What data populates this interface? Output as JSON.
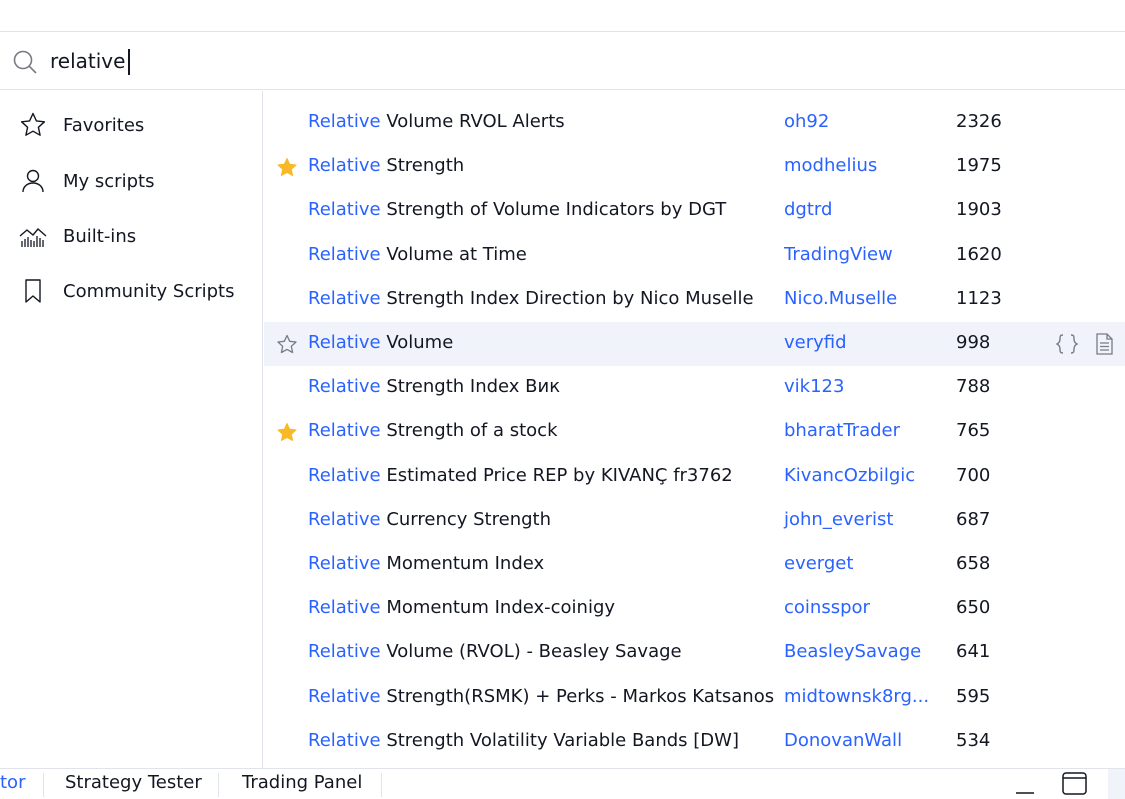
{
  "search": {
    "value": "relative"
  },
  "sidebar": {
    "items": [
      {
        "label": "Favorites",
        "icon": "star-outline-icon"
      },
      {
        "label": "My scripts",
        "icon": "user-icon"
      },
      {
        "label": "Built-ins",
        "icon": "chart-icon"
      },
      {
        "label": "Community Scripts",
        "icon": "bookmark-icon"
      }
    ]
  },
  "results": [
    {
      "hit": "Relative",
      "rest": " Volume RVOL Alerts",
      "author": "oh92",
      "count": "2326",
      "favorite": "none"
    },
    {
      "hit": "Relative",
      "rest": " Strength",
      "author": "modhelius",
      "count": "1975",
      "favorite": "filled"
    },
    {
      "hit": "Relative",
      "rest": " Strength of Volume Indicators by DGT",
      "author": "dgtrd",
      "count": "1903",
      "favorite": "none"
    },
    {
      "hit": "Relative",
      "rest": " Volume at Time",
      "author": "TradingView",
      "count": "1620",
      "favorite": "none"
    },
    {
      "hit": "Relative",
      "rest": " Strength Index Direction by Nico Muselle",
      "author": "Nico.Muselle",
      "count": "1123",
      "favorite": "none"
    },
    {
      "hit": "Relative",
      "rest": " Volume",
      "author": "veryfid",
      "count": "998",
      "favorite": "outline"
    },
    {
      "hit": "Relative",
      "rest": " Strength Index Вик",
      "author": "vik123",
      "count": "788",
      "favorite": "none"
    },
    {
      "hit": "Relative",
      "rest": " Strength of a stock",
      "author": "bharatTrader",
      "count": "765",
      "favorite": "filled"
    },
    {
      "hit": "Relative",
      "rest": " Estimated Price REP by KIVANÇ fr3762",
      "author": "KivancOzbilgic",
      "count": "700",
      "favorite": "none"
    },
    {
      "hit": "Relative",
      "rest": " Currency Strength",
      "author": "john_everist",
      "count": "687",
      "favorite": "none"
    },
    {
      "hit": "Relative",
      "rest": " Momentum Index",
      "author": "everget",
      "count": "658",
      "favorite": "none"
    },
    {
      "hit": "Relative",
      "rest": " Momentum Index-coinigy",
      "author": "coinsspor",
      "count": "650",
      "favorite": "none"
    },
    {
      "hit": "Relative",
      "rest": " Volume (RVOL) - Beasley Savage",
      "author": "BeasleySavage",
      "count": "641",
      "favorite": "none"
    },
    {
      "hit": "Relative",
      "rest": " Strength(RSMK) + Perks - Markos Katsanos",
      "author": "midtownsk8rg...",
      "count": "595",
      "favorite": "none"
    },
    {
      "hit": "Relative",
      "rest": " Strength Volatility Variable Bands [DW]",
      "author": "DonovanWall",
      "count": "534",
      "favorite": "none"
    }
  ],
  "highlighted_row_actions": [
    "source-code-icon",
    "document-icon"
  ],
  "bottom_bar": {
    "tabs": [
      "tor",
      "Strategy Tester",
      "Trading Panel"
    ],
    "icons": [
      "minimize-icon",
      "maximize-icon"
    ]
  },
  "colors": {
    "accent": "#2962ff",
    "star": "#f9b825",
    "highlight": "#f0f3fa",
    "text": "#131722"
  }
}
